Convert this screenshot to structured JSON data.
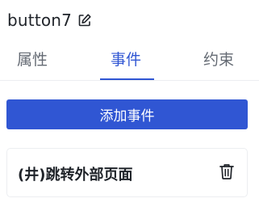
{
  "component": {
    "name": "button7",
    "edit_icon": "edit-icon"
  },
  "tabs": [
    {
      "label": "属性",
      "active": false
    },
    {
      "label": "事件",
      "active": true
    },
    {
      "label": "约束",
      "active": false
    }
  ],
  "actions": {
    "add_event_label": "添加事件"
  },
  "events": [
    {
      "label": "(井)跳转外部页面",
      "delete_icon": "trash-icon"
    }
  ],
  "colors": {
    "accent": "#3056d3",
    "text": "#1f2329",
    "muted_text": "#646a73",
    "border": "#eceef1"
  }
}
